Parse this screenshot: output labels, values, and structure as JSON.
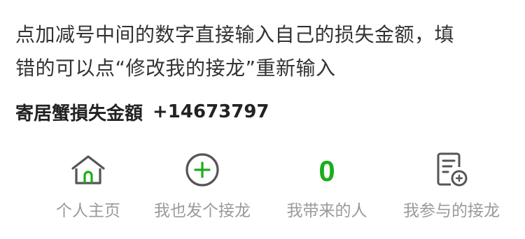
{
  "instructions": {
    "line1": "点加减号中间的数字直接输入自己的损失金额，填",
    "line2": "错的可以点“修改我的接龙”重新输入"
  },
  "summary": {
    "name": "寄居蟹損失金額",
    "amount": "+14673797"
  },
  "nav": {
    "items": [
      {
        "label": "个人主页",
        "icon": "home-icon"
      },
      {
        "label": "我也发个接龙",
        "icon": "add-circle-icon"
      },
      {
        "label": "我带来的人",
        "count": "0"
      },
      {
        "label": "我参与的接龙",
        "icon": "document-edit-icon"
      }
    ]
  },
  "colors": {
    "accent": "#1AAD19",
    "icon": "#555555",
    "label": "#9a9a9a",
    "text": "#333333"
  }
}
